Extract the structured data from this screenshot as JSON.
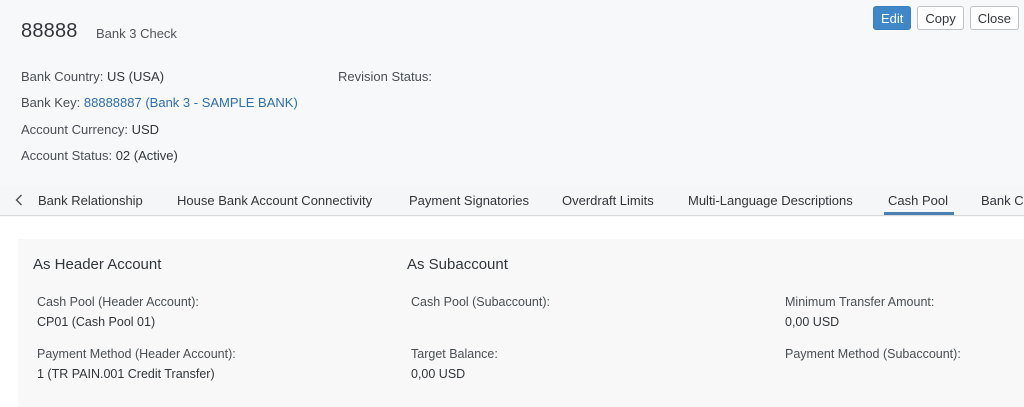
{
  "header": {
    "object_id": "88888",
    "subtitle": "Bank 3 Check",
    "buttons": {
      "edit": "Edit",
      "copy": "Copy",
      "close": "Close"
    },
    "attributes": {
      "bank_country": {
        "label": "Bank Country:",
        "value": "US (USA)"
      },
      "bank_key": {
        "label": "Bank Key:",
        "value": "88888887 (Bank 3 - SAMPLE BANK)"
      },
      "account_currency": {
        "label": "Account Currency:",
        "value": "USD"
      },
      "account_status": {
        "label": "Account Status:",
        "value": "02 (Active)"
      },
      "revision_status": {
        "label": "Revision Status:",
        "value": ""
      }
    }
  },
  "tabs": [
    {
      "label": "Bank Relationship"
    },
    {
      "label": "House Bank Account Connectivity"
    },
    {
      "label": "Payment Signatories"
    },
    {
      "label": "Overdraft Limits"
    },
    {
      "label": "Multi-Language Descriptions"
    },
    {
      "label": "Cash Pool",
      "active": true
    },
    {
      "label": "Bank C"
    }
  ],
  "cash_pool": {
    "header_section": {
      "title": "As Header Account",
      "cash_pool_label": "Cash Pool (Header Account):",
      "cash_pool_value": "CP01 (Cash Pool 01)",
      "payment_method_label": "Payment Method (Header Account):",
      "payment_method_value": "1 (TR PAIN.001 Credit Transfer)"
    },
    "sub_section": {
      "title": "As Subaccount",
      "cash_pool_label": "Cash Pool (Subaccount):",
      "cash_pool_value": "",
      "target_balance_label": "Target Balance:",
      "target_balance_value": "0,00  USD",
      "min_transfer_label": "Minimum Transfer Amount:",
      "min_transfer_value": "0,00  USD",
      "payment_method_label": "Payment Method (Subaccount):",
      "payment_method_value": ""
    }
  },
  "colors": {
    "primary_button": "#3f87c9",
    "link": "#2f6ead",
    "tab_indicator": "#4a7fb0"
  },
  "icons": {
    "tab_scroll_left": "chevron-left-icon"
  }
}
